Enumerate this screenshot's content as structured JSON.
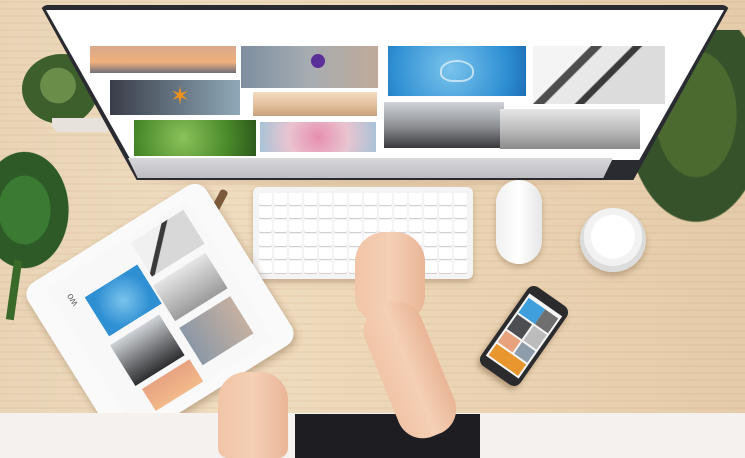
{
  "scene": {
    "surface": "wooden desk",
    "colors": {
      "wood": "#ead3b2",
      "monitor_frame": "#2a2b30",
      "screen_white": "#ffffff",
      "sky_blue": "#4aa8e0",
      "jellyfish_blue": "#3e9fdc",
      "plant_green": "#3f6b2e",
      "skin": "#f2c8ab"
    }
  },
  "monitor": {
    "gallery": [
      {
        "name": "sunset-pier",
        "color": "#e9a27e"
      },
      {
        "name": "starfish",
        "color": "#e8962e"
      },
      {
        "name": "green-leaves",
        "color": "#5aa43c"
      },
      {
        "name": "purple-flower",
        "color": "#8f9cab"
      },
      {
        "name": "beach-horizon",
        "color": "#e5c7a6"
      },
      {
        "name": "cherry-blossom",
        "color": "#d9a6bd"
      },
      {
        "name": "jellyfish",
        "color": "#3e9fdc"
      },
      {
        "name": "coastal-rocks",
        "color": "#5f6063"
      },
      {
        "name": "bridge-tower",
        "color": "#707070"
      },
      {
        "name": "beach-waves",
        "color": "#cfcfcf"
      }
    ]
  },
  "tablet": {
    "label": "wo"
  },
  "icons": [
    "monitor-icon",
    "keyboard-icon",
    "mouse-icon",
    "tablet-icon",
    "phone-icon",
    "coffee-cup-icon"
  ]
}
